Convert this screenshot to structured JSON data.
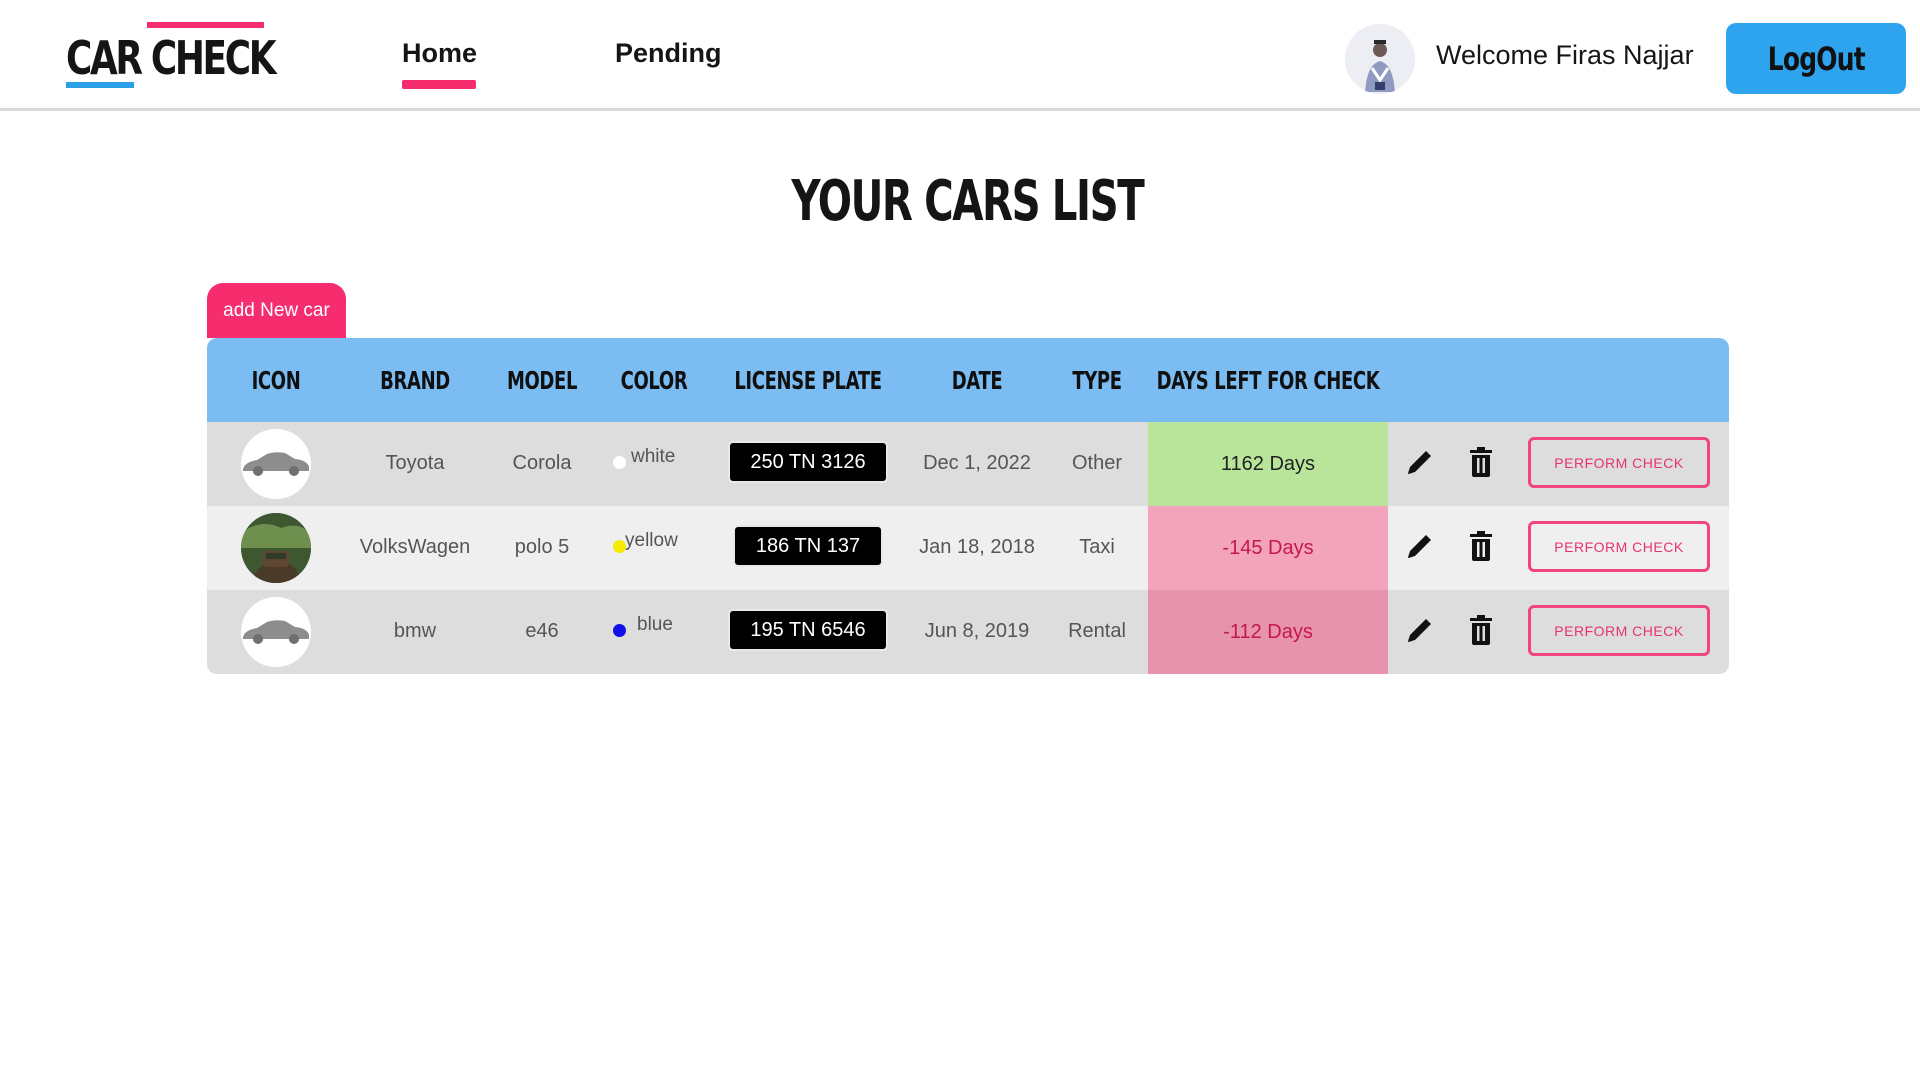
{
  "header": {
    "logo_text": "CAR CHECK",
    "nav": {
      "home": "Home",
      "pending": "Pending"
    },
    "active_nav": "home",
    "welcome": "Welcome Firas Najjar",
    "logout": "LogOut"
  },
  "main": {
    "title": "YOUR CARS LIST",
    "add_button": "add New car"
  },
  "table": {
    "columns": [
      "ICON",
      "BRAND",
      "MODEL",
      "COLOR",
      "LICENSE PLATE",
      "DATE",
      "TYPE",
      "DAYS LEFT FOR CHECK"
    ],
    "rows": [
      {
        "icon": "car-silhouette-icon",
        "brand": "Toyota",
        "model": "Corola",
        "color_name": "white",
        "color_hex": "#ffffff",
        "plate": "250 TN 3126",
        "date": "Dec 1, 2022",
        "type": "Other",
        "days_left": "1162 Days",
        "status_bg": "#b9e59a",
        "status_fg": "#222222",
        "action_label": "PERFORM CHECK"
      },
      {
        "icon": "car-photo",
        "brand": "VolksWagen",
        "model": "polo 5",
        "color_name": "yellow",
        "color_hex": "#f5ea00",
        "plate": "186 TN 137",
        "date": "Jan 18, 2018",
        "type": "Taxi",
        "days_left": "-145 Days",
        "status_bg": "#f4a3bd",
        "status_fg": "#c4184d",
        "action_label": "PERFORM CHECK"
      },
      {
        "icon": "car-silhouette-icon",
        "brand": "bmw",
        "model": "e46",
        "color_name": "blue",
        "color_hex": "#1010e8",
        "plate": "195 TN 6546",
        "date": "Jun 8, 2019",
        "type": "Rental",
        "days_left": "-112 Days",
        "status_bg": "#e893ad",
        "status_fg": "#c4184d",
        "action_label": "PERFORM CHECK"
      }
    ]
  },
  "colors": {
    "accent_pink": "#f52d6e",
    "accent_blue": "#2ea3ee",
    "table_header": "#7bbdf3"
  }
}
